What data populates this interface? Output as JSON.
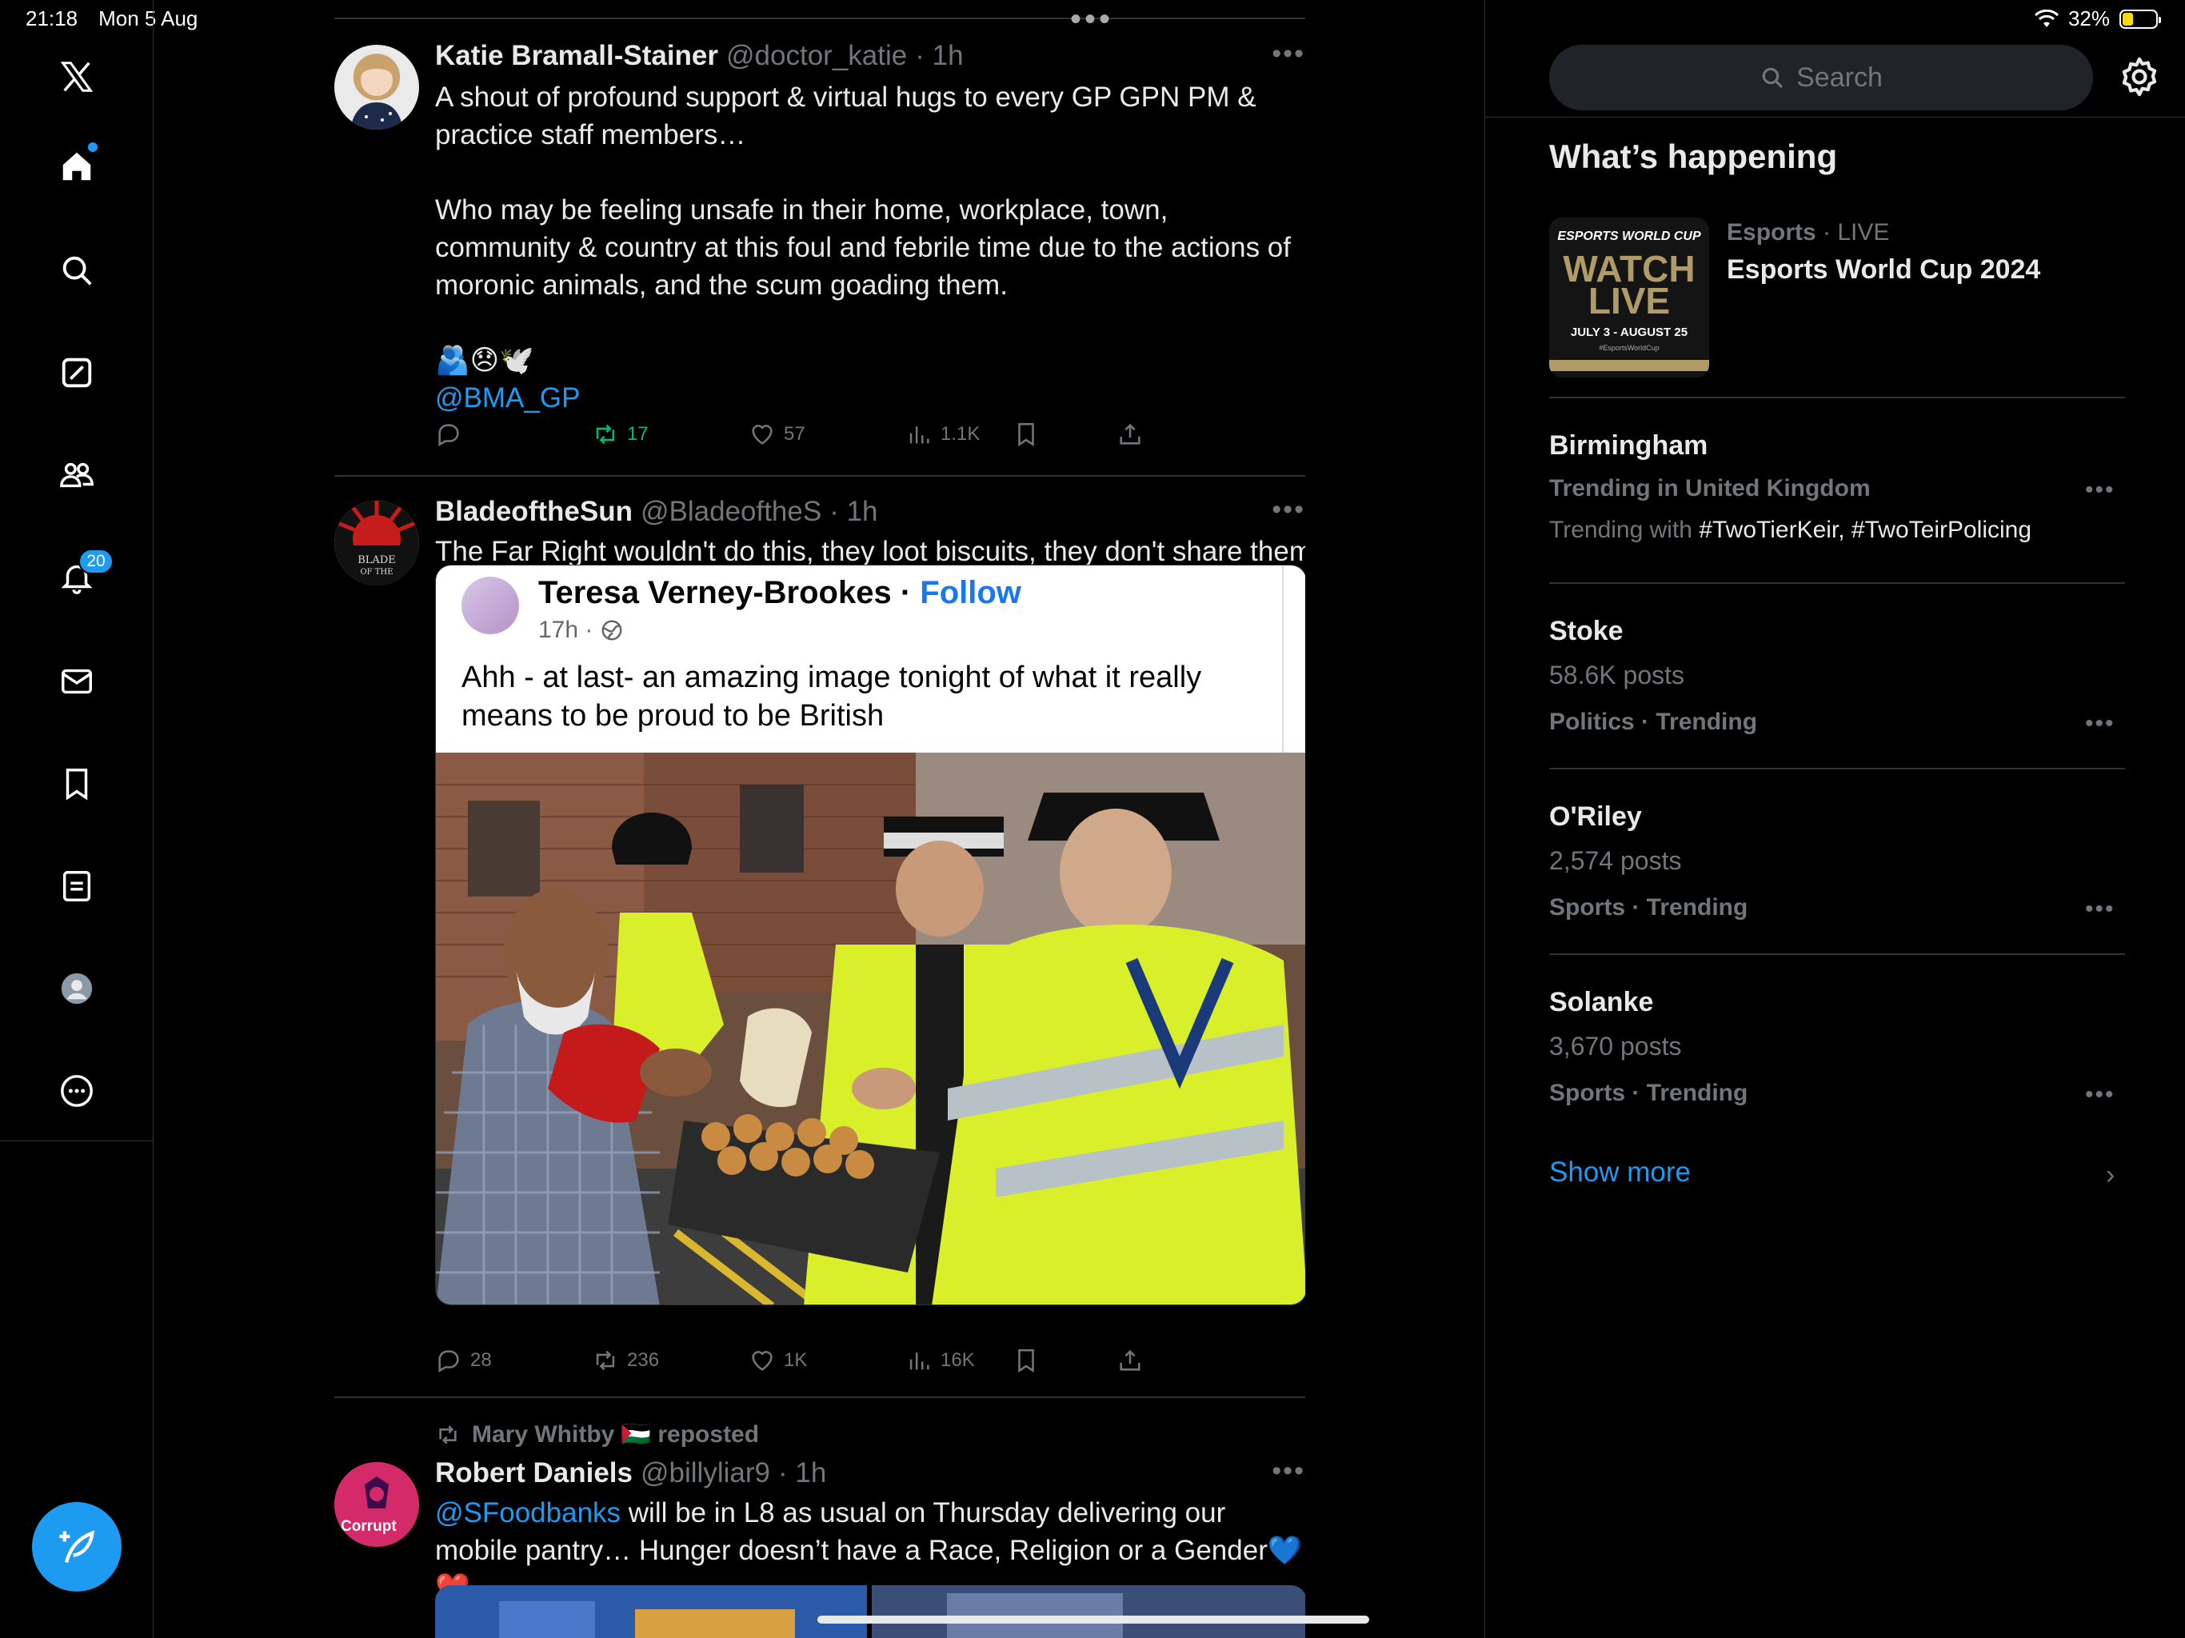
{
  "status_bar": {
    "time": "21:18",
    "date": "Mon 5 Aug",
    "battery": "32%",
    "battery_level": 0.32
  },
  "nav": {
    "items": [
      "x-logo",
      "home",
      "search",
      "grok",
      "communities",
      "notifications",
      "messages",
      "bookmarks",
      "lists",
      "profile",
      "more"
    ],
    "notifications_badge": "20"
  },
  "feed": {
    "posts": [
      {
        "name": "Katie Bramall-Stainer",
        "handle": "@doctor_katie",
        "time": "· 1h",
        "text_1": "A shout of profound support & virtual hugs to every GP GPN PM & practice staff members…",
        "text_2": "Who may be feeling unsafe in their home, workplace, town, community & country at this foul and febrile time due to the actions of moronic animals, and the scum goading them.",
        "emojis": "🫂😞🕊️",
        "mention": "@BMA_GP",
        "replies": "",
        "reposts": "17",
        "likes": "57",
        "views": "1.1K"
      },
      {
        "name": "BladeoftheSun",
        "handle": "@BladeoftheS",
        "time": "· 1h",
        "text": "The Far Right wouldn't do this, they loot biscuits, they don't share them.",
        "embed": {
          "name": "Teresa Verney-Brookes",
          "follow": "Follow",
          "meta": "17h ·",
          "text": "Ahh - at last-  an amazing image tonight of what it really means to be proud to be British"
        },
        "replies": "28",
        "reposts": "236",
        "likes": "1K",
        "views": "16K"
      },
      {
        "repost_by": "Mary Whitby 🇵🇸 reposted",
        "name": "Robert Daniels",
        "handle": "@billyliar9",
        "time": "· 1h",
        "mention": "@SFoodbanks",
        "text": " will be in L8 as usual on Thursday delivering our mobile pantry… Hunger doesn’t have a Race, Religion or a Gender💙❤️",
        "avatar_text": "Corrupt"
      }
    ]
  },
  "sidebar": {
    "search_placeholder": "Search",
    "section_title": "What’s happening",
    "featured": {
      "category": "Esports",
      "live": "· LIVE",
      "title": "Esports World Cup 2024",
      "thumb_lines": [
        "ESPORTS WORLD CUP",
        "WATCH",
        "LIVE",
        "JULY 3 - AUGUST 25",
        "#EsportsWorldCup"
      ]
    },
    "trends": [
      {
        "name": "Birmingham",
        "category": "Trending in United Kingdom",
        "with_label": "Trending with ",
        "tags": "#TwoTierKeir, #TwoTeirPolicing"
      },
      {
        "name": "Stoke",
        "posts": "58.6K posts",
        "category": "Politics · Trending"
      },
      {
        "name": "O'Riley",
        "posts": "2,574 posts",
        "category": "Sports · Trending"
      },
      {
        "name": "Solanke",
        "posts": "3,670 posts",
        "category": "Sports · Trending"
      }
    ],
    "show_more": "Show more"
  },
  "colors": {
    "accent": "#1d9bf0",
    "background": "#000000",
    "muted": "#71767b",
    "repost_green": "#00ba7c"
  }
}
